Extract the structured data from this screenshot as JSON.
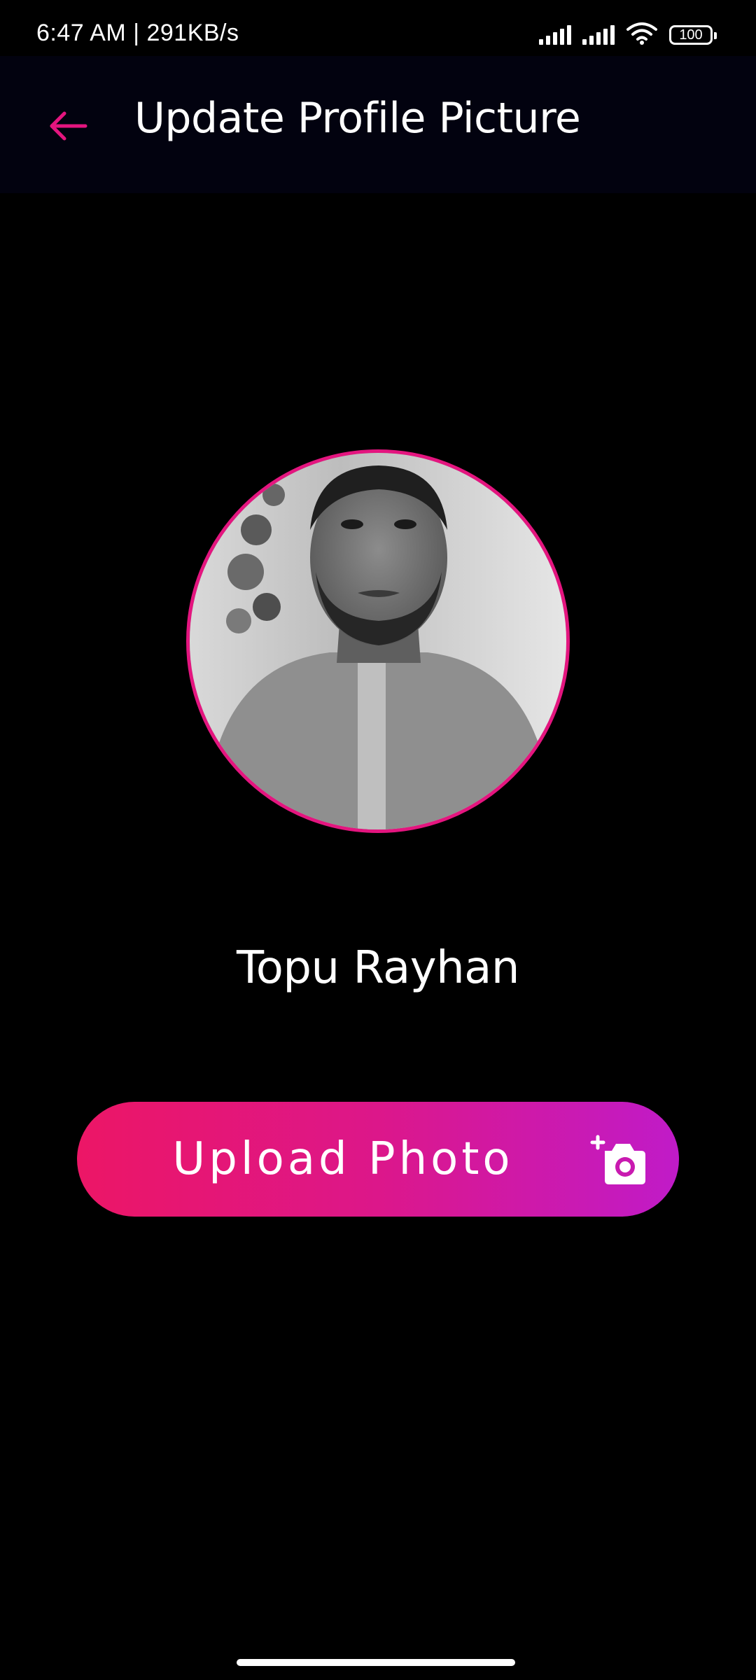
{
  "status_bar": {
    "time_and_speed": "6:47 AM | 291KB/s",
    "battery": "100",
    "icons": [
      "signal-icon",
      "signal-icon",
      "wifi-icon",
      "battery-icon"
    ]
  },
  "app_bar": {
    "back_icon": "arrow-left-icon",
    "title": "Update Profile Picture"
  },
  "profile": {
    "name": "Topu Rayhan"
  },
  "upload_button": {
    "label": "Upload Photo",
    "icon": "add-camera-icon"
  },
  "colors": {
    "background": "#000000",
    "app_bar": "#02020f",
    "accent": "#e4157f",
    "gradient_start": "#ec1666",
    "gradient_end": "#c01bc8",
    "text": "#ffffff"
  }
}
